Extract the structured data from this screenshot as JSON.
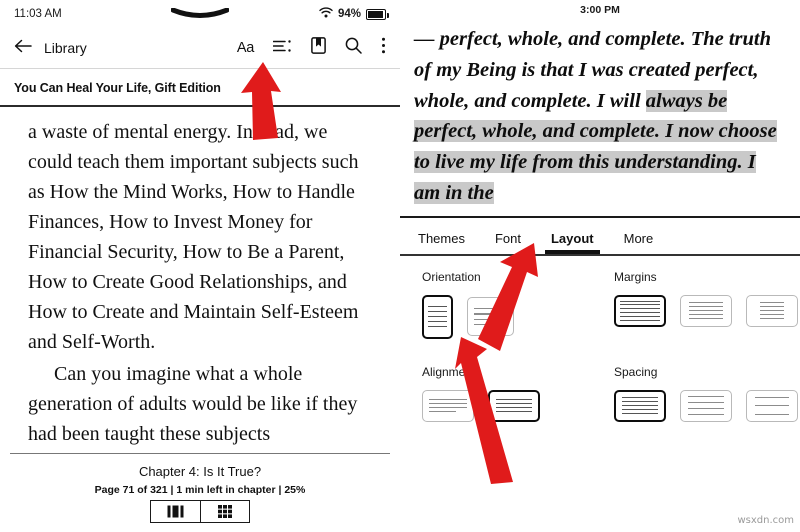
{
  "left": {
    "status": {
      "time": "11:03 AM",
      "battery_percent": "94%",
      "wifi_icon": "wifi-icon",
      "battery_icon": "battery-icon",
      "handle_icon": "chevron-down-handle-icon"
    },
    "toolbar": {
      "back_icon": "back-arrow-icon",
      "back_label": "Library",
      "font_label": "Aa",
      "toc_icon": "table-of-contents-icon",
      "bookmark_icon": "bookmark-icon",
      "search_icon": "search-icon",
      "more_icon": "more-vertical-icon"
    },
    "book_title": "You Can Heal Your Life, Gift Edition",
    "body": {
      "paragraph_1": "a waste of mental energy. Instead, we could teach them important subjects such as How the Mind Works, How to Handle Finances, How to Invest Money for Financial Security, How to Be a Parent, How to Create Good Relationships, and How to Create and Maintain Self-Esteem and Self-Worth.",
      "paragraph_2": "Can you imagine what a whole generation of adults would be like if they had been taught these subjects"
    },
    "footer": {
      "chapter": "Chapter 4: Is It True?",
      "page_info": "Page 71 of 321 | 1 min left in chapter | 25%"
    },
    "view_toggle": {
      "single_icon": "single-column-view-icon",
      "grid_icon": "grid-view-icon"
    }
  },
  "right": {
    "status": {
      "time": "3:00 PM"
    },
    "quote": {
      "plain_1": "— perfect, whole, and complete. The truth of my Being is that I was created perfect, whole, and complete. I will ",
      "highlighted": "always be perfect, whole, and complete. I now choose to live my life from this understanding. I am in the",
      "clipped_line": "this understanding. I am in the"
    },
    "tabs": [
      {
        "label": "Themes",
        "active": false
      },
      {
        "label": "Font",
        "active": false
      },
      {
        "label": "Layout",
        "active": true
      },
      {
        "label": "More",
        "active": false
      }
    ],
    "settings": {
      "orientation": {
        "label": "Orientation",
        "options": [
          {
            "name": "portrait",
            "selected": true,
            "lines": 5
          },
          {
            "name": "landscape",
            "selected": false,
            "lines": 4
          }
        ]
      },
      "margins": {
        "label": "Margins",
        "options": [
          {
            "name": "narrow",
            "selected": true,
            "lines": 6
          },
          {
            "name": "medium",
            "selected": false,
            "lines": 5
          },
          {
            "name": "wide",
            "selected": false,
            "lines": 5
          }
        ]
      },
      "alignment": {
        "label": "Alignment",
        "options": [
          {
            "name": "left-aligned",
            "selected": false,
            "lines": 4
          },
          {
            "name": "justified",
            "selected": true,
            "lines": 4
          }
        ]
      },
      "spacing": {
        "label": "Spacing",
        "options": [
          {
            "name": "tight",
            "selected": true,
            "lines": 5
          },
          {
            "name": "medium",
            "selected": false,
            "lines": 4
          },
          {
            "name": "loose",
            "selected": false,
            "lines": 3
          }
        ]
      }
    }
  },
  "annotations": {
    "arrow_color": "#e01b1b",
    "arrow_1_target": "table-of-contents-icon",
    "arrow_2_target": "layout-tab",
    "arrow_3_target": "orientation-portrait-option"
  },
  "watermark": "wsxdn.com"
}
